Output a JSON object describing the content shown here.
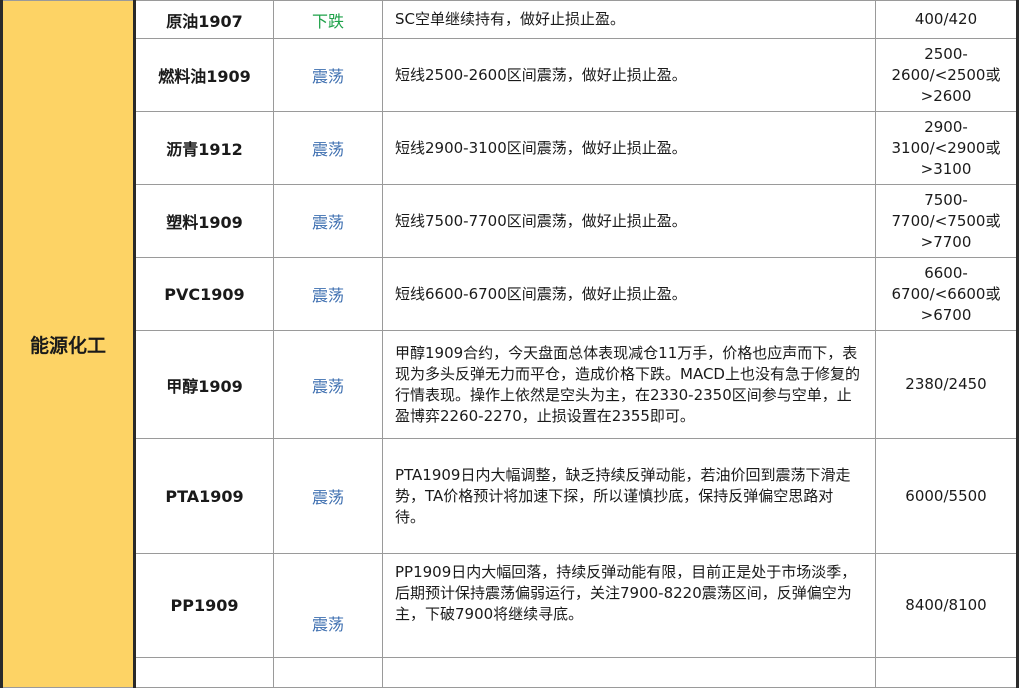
{
  "sector_label": "能源化工",
  "rows": [
    {
      "name": "原油1907",
      "trend": "下跌",
      "comment": "SC空单继续持有，做好止损止盈。",
      "target": "400/420"
    },
    {
      "name": "燃料油1909",
      "trend": "震荡",
      "comment": "短线2500-2600区间震荡，做好止损止盈。",
      "target": "2500-\n2600/<2500或\n>2600"
    },
    {
      "name": "沥青1912",
      "trend": "震荡",
      "comment": "短线2900-3100区间震荡，做好止损止盈。",
      "target": "2900-\n3100/<2900或\n>3100"
    },
    {
      "name": "塑料1909",
      "trend": "震荡",
      "comment": "短线7500-7700区间震荡，做好止损止盈。",
      "target": "7500-\n7700/<7500或\n>7700"
    },
    {
      "name": "PVC1909",
      "trend": "震荡",
      "comment": "短线6600-6700区间震荡，做好止损止盈。",
      "target": "6600-\n6700/<6600或\n>6700"
    },
    {
      "name": "甲醇1909",
      "trend": "震荡",
      "comment": "甲醇1909合约，今天盘面总体表现减仓11万手，价格也应声而下，表现为多头反弹无力而平仓，造成价格下跌。MACD上也没有急于修复的行情表现。操作上依然是空头为主，在2330-2350区间参与空单，止盈博弈2260-2270，止损设置在2355即可。",
      "target": "2380/2450"
    },
    {
      "name": "PTA1909",
      "trend": "震荡",
      "comment": "PTA1909日内大幅调整，缺乏持续反弹动能，若油价回到震荡下滑走势，TA价格预计将加速下探，所以谨慎抄底，保持反弹偏空思路对待。",
      "target": "6000/5500"
    },
    {
      "name": "PP1909",
      "trend": "震荡",
      "comment": "PP1909日内大幅回落，持续反弹动能有限，目前正是处于市场淡季，后期预计保持震荡偏弱运行，关注7900-8220震荡区间，反弹偏空为主，下破7900将继续寻底。",
      "target": "8400/8100"
    }
  ],
  "colors": {
    "sector_bg": "#fdd365",
    "trend_down": "#1fa24a",
    "trend_range": "#3e6fb0"
  }
}
